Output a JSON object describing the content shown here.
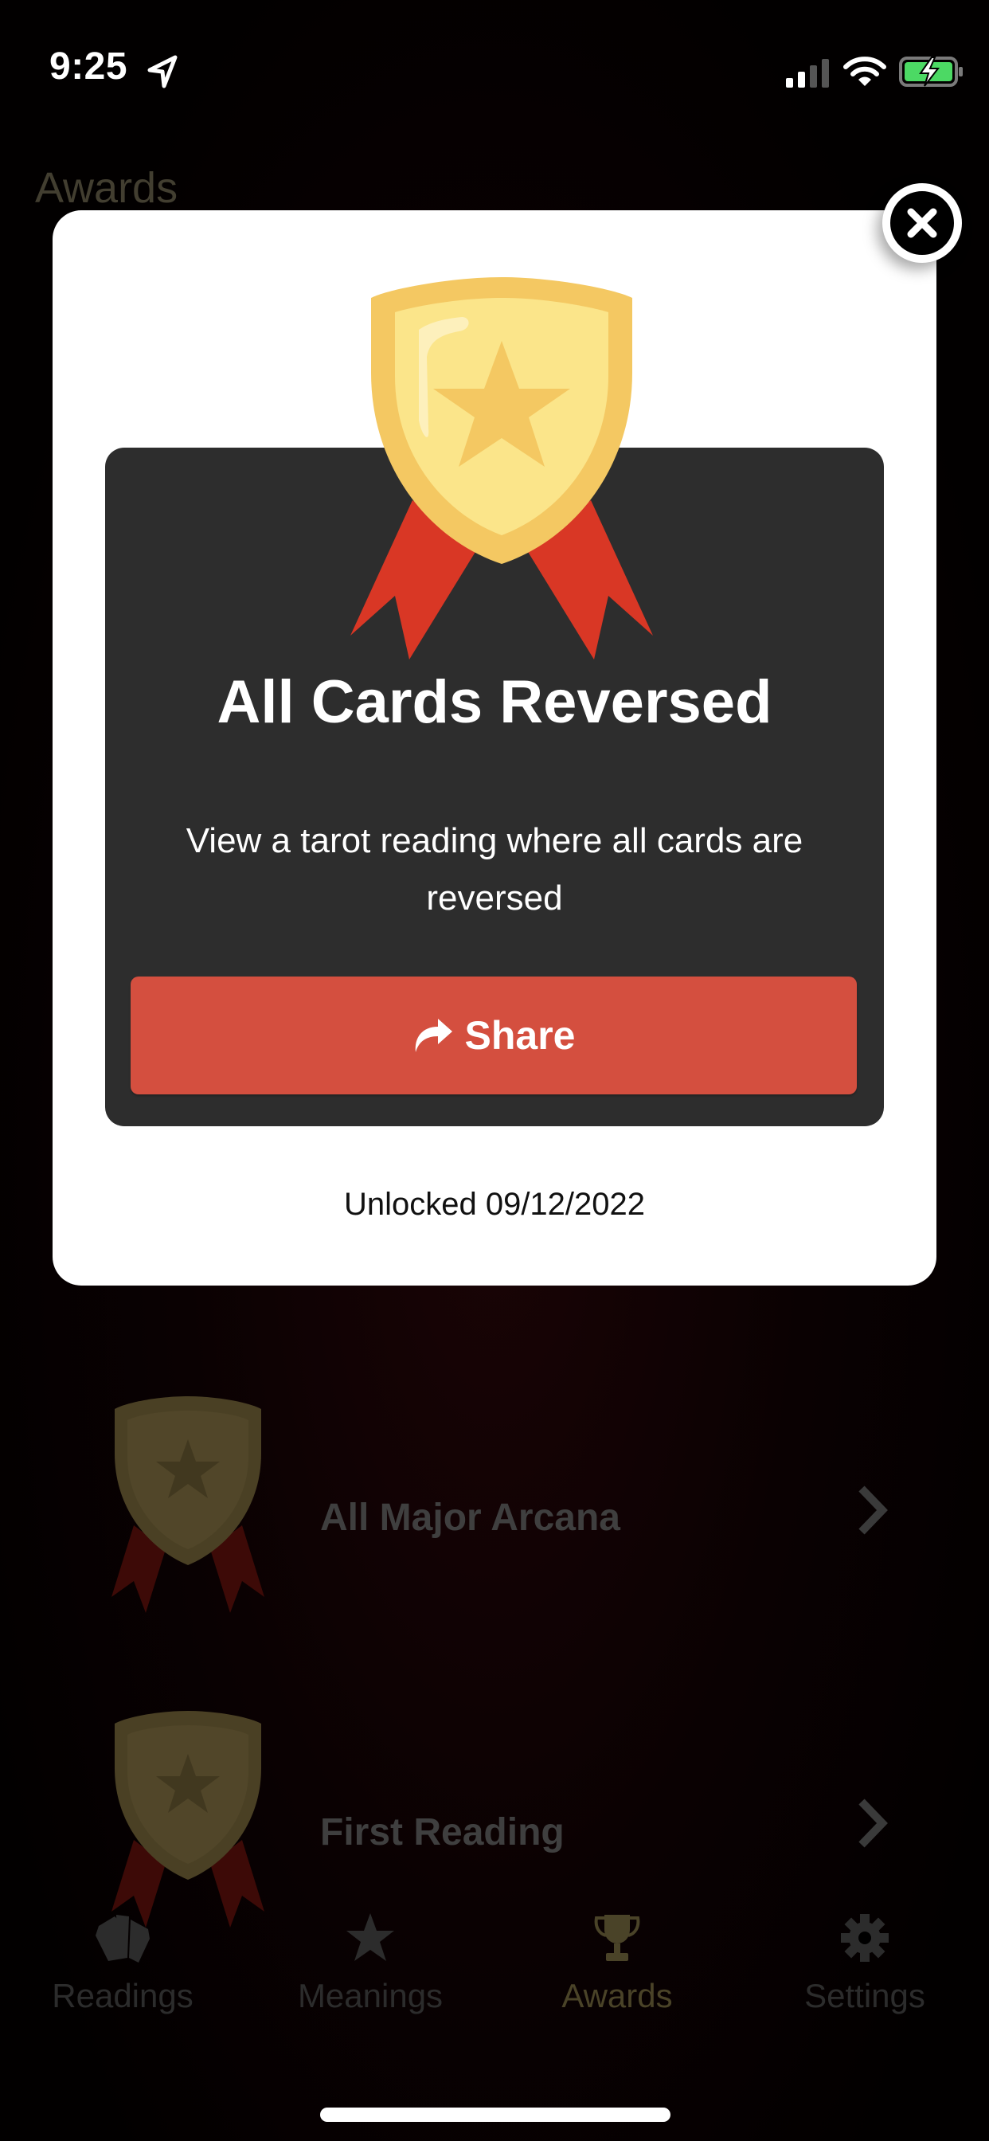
{
  "status_bar": {
    "time": "9:25",
    "location_icon": "location-arrow-icon",
    "signal_icon": "cellular-signal-icon",
    "wifi_icon": "wifi-icon",
    "battery_icon": "battery-charging-icon",
    "battery_color": "#4cd964"
  },
  "background_page": {
    "title": "Awards",
    "awards": [
      {
        "title": "All Major Arcana",
        "icon": "shield-badge-icon",
        "chevron": "chevron-right-icon"
      },
      {
        "title": "First Reading",
        "icon": "shield-badge-icon",
        "chevron": "chevron-right-icon"
      }
    ],
    "tabs": [
      {
        "label": "Readings",
        "icon": "cards-icon",
        "active": false
      },
      {
        "label": "Meanings",
        "icon": "star-icon",
        "active": false
      },
      {
        "label": "Awards",
        "icon": "trophy-icon",
        "active": true
      },
      {
        "label": "Settings",
        "icon": "gear-icon",
        "active": false
      }
    ]
  },
  "modal": {
    "close_icon": "close-icon",
    "badge_icon": "shield-badge-icon",
    "title": "All Cards Reversed",
    "description": "View a tarot reading where all cards are reversed",
    "share_button": {
      "label": "Share",
      "icon": "share-arrow-icon"
    },
    "unlocked_text": "Unlocked 09/12/2022"
  },
  "colors": {
    "share_button": "#d44f3f",
    "panel_background": "#2d2d2d",
    "badge_gold": "#f4c862",
    "badge_inner": "#fbe58a",
    "ribbon_red": "#d93725"
  }
}
